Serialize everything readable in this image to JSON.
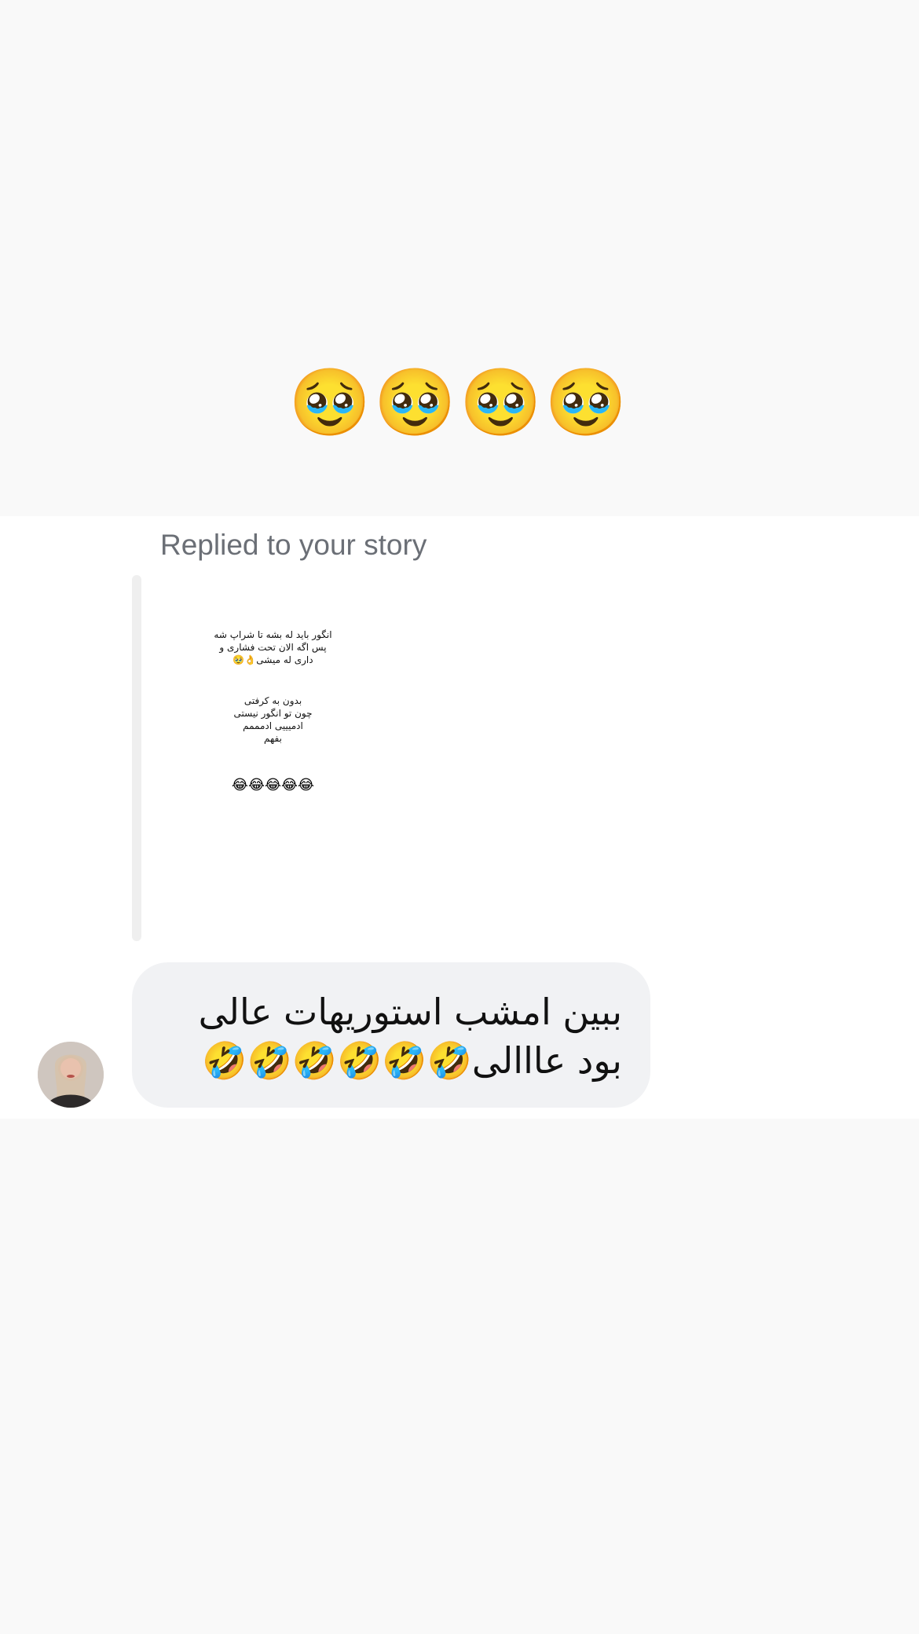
{
  "reaction": {
    "emojis": "🥹🥹🥹🥹"
  },
  "reply": {
    "label": "Replied to your story"
  },
  "story": {
    "paragraph1": "انگور باید له بشه تا شراپ شه\nپس اگه الان تحت فشاری و\nداری له میشی👌🥹",
    "paragraph2": "بدون به کرفتی\nچون تو انگور نیستی\nادمیییی ادمممم\nبفهم",
    "emojis": "😂😂😂😂😂"
  },
  "message": {
    "text": "ببین امشب استوریهات عالی بود عااالی🤣🤣🤣🤣🤣🤣"
  },
  "avatar": {
    "icon": "user-avatar-photo"
  }
}
